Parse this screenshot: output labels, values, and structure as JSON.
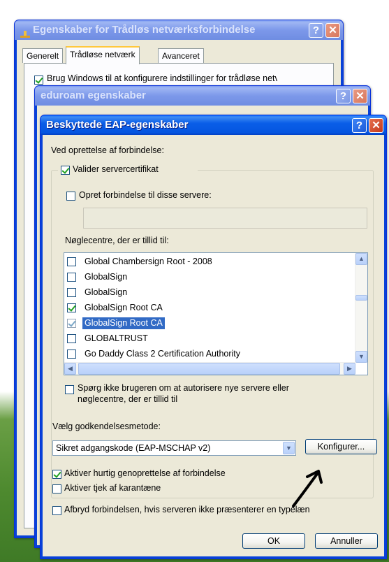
{
  "back_window": {
    "title": "Egenskaber for Trådløs netværksforbindelse",
    "tabs": [
      "Generelt",
      "Trådløse netværk",
      "Avanceret"
    ],
    "selected_tab": 1,
    "partial_text": "Brug Windows til at konfigurere indstillinger for trådløse netværk"
  },
  "middle_window": {
    "title": "eduroam egenskaber"
  },
  "dialog": {
    "title": "Beskyttede EAP-egenskaber",
    "connect_section_label": "Ved oprettelse af forbindelse:",
    "validate_cert_label": "Valider servercertifikat",
    "validate_cert_checked": true,
    "connect_servers_label": "Opret forbindelse til disse servere:",
    "connect_servers_checked": false,
    "server_field_value": "",
    "trusted_roots_label": "Nøglecentre, der er tillid til:",
    "trusted_roots": [
      {
        "name": "Global Chambersign Root - 2008",
        "checked": false,
        "selected": false
      },
      {
        "name": "GlobalSign",
        "checked": false,
        "selected": false
      },
      {
        "name": "GlobalSign",
        "checked": false,
        "selected": false
      },
      {
        "name": "GlobalSign Root CA",
        "checked": true,
        "selected": false
      },
      {
        "name": "GlobalSign Root CA",
        "checked": true,
        "selected": true
      },
      {
        "name": "GLOBALTRUST",
        "checked": false,
        "selected": false
      },
      {
        "name": "Go Daddy Class 2 Certification Authority",
        "checked": false,
        "selected": false
      }
    ],
    "dont_prompt_label_line1": "Spørg ikke brugeren om at autorisere nye servere eller",
    "dont_prompt_label_line2": "nøglecentre, der er tillid til",
    "dont_prompt_checked": false,
    "auth_method_label": "Vælg godkendelsesmetode:",
    "auth_method_value": "Sikret adgangskode (EAP-MSCHAP v2)",
    "configure_button": "Konfigurer...",
    "fast_reconnect_label": "Aktiver hurtig genoprettelse af forbindelse",
    "fast_reconnect_checked": true,
    "quarantine_label": "Aktiver tjek af karantæne",
    "quarantine_checked": false,
    "disconnect_label": "Afbryd forbindelsen, hvis serveren ikke præsenterer en typelæn",
    "disconnect_checked": false,
    "ok_button": "OK",
    "cancel_button": "Annuller"
  },
  "title_buttons": {
    "help": "?",
    "close": "✕"
  },
  "icons": {
    "network": "network-connection-icon",
    "scroll_up": "▲",
    "scroll_down": "▼",
    "scroll_left": "◀",
    "scroll_right": "▶",
    "combo_arrow": "▼"
  },
  "colors": {
    "titlebar": "#0a5ee8",
    "selection": "#316ac5",
    "dialog_bg": "#ece9d8"
  }
}
